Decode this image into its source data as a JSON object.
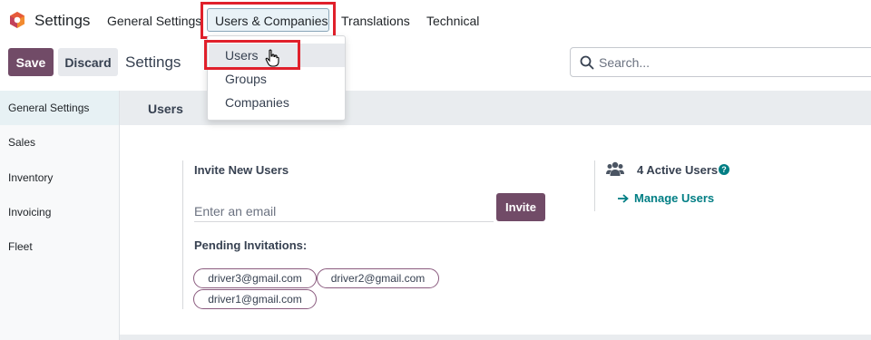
{
  "app": {
    "name": "Settings"
  },
  "nav": {
    "items": [
      "General Settings",
      "Users & Companies",
      "Translations",
      "Technical"
    ]
  },
  "control_panel": {
    "save_label": "Save",
    "discard_label": "Discard",
    "breadcrumb": "Settings",
    "search_placeholder": "Search..."
  },
  "sidebar": {
    "items": [
      "General Settings",
      "Sales",
      "Inventory",
      "Invoicing",
      "Fleet"
    ]
  },
  "dropdown": {
    "items": [
      "Users",
      "Groups",
      "Companies"
    ]
  },
  "section": {
    "title": "Users",
    "invite_label": "Invite New Users",
    "email_placeholder": "Enter an email",
    "invite_button": "Invite",
    "pending_label": "Pending Invitations:",
    "pending": [
      "driver3@gmail.com",
      "driver2@gmail.com",
      "driver1@gmail.com"
    ],
    "active_users": "4 Active Users",
    "manage_users": "Manage Users"
  },
  "colors": {
    "brand": "#714b67",
    "link": "#017e84",
    "highlight": "#e0202b"
  }
}
